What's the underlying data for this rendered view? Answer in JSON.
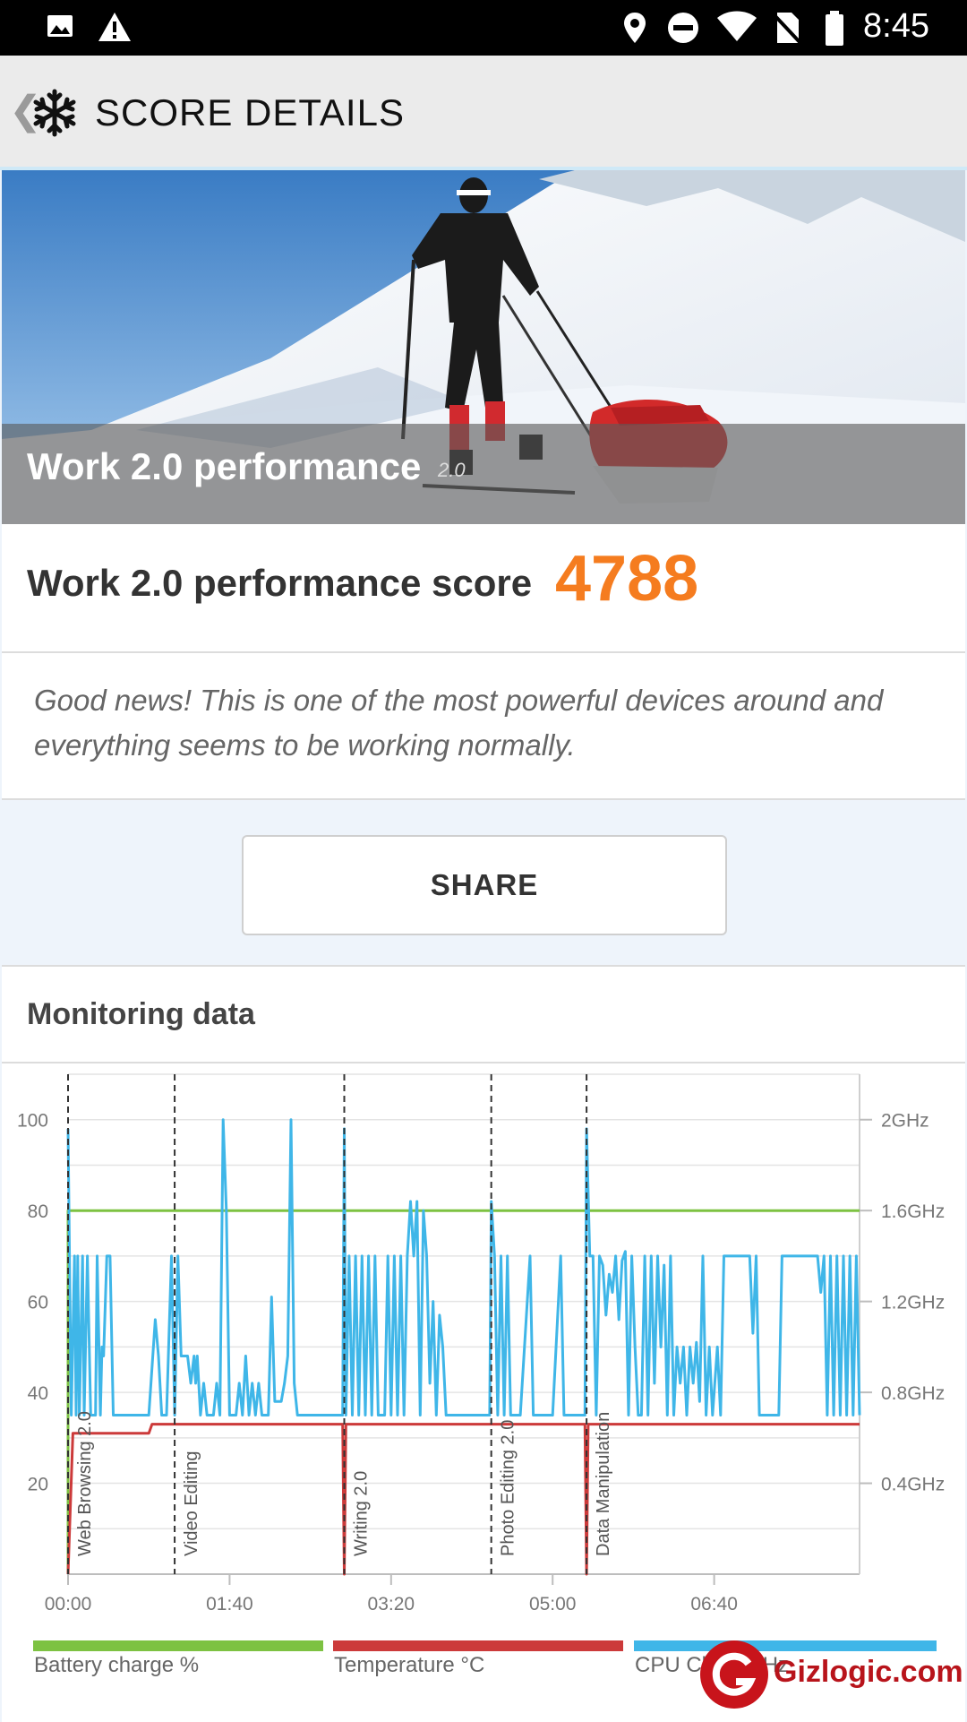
{
  "status_bar": {
    "time": "8:45",
    "icons": [
      "image-icon",
      "warning-icon",
      "location-icon",
      "dnd-icon",
      "wifi-icon",
      "no-sim-icon",
      "battery-icon"
    ]
  },
  "app_bar": {
    "title": "SCORE DETAILS",
    "icons": [
      "back-chevron-icon",
      "snowflake-icon"
    ]
  },
  "hero": {
    "title": "Work 2.0 performance",
    "version": "2.0"
  },
  "score": {
    "label": "Work 2.0 performance score",
    "value": "4788",
    "value_color": "#f57c1f"
  },
  "message": "Good news! This is one of the most powerful devices around and everything seems to be working normally.",
  "share_label": "SHARE",
  "monitoring": {
    "title": "Monitoring data",
    "legend": [
      {
        "label": "Battery charge %",
        "color": "#7dc242"
      },
      {
        "label": "Temperature °C",
        "color": "#cc3a3a"
      },
      {
        "label": "CPU Clock GHz",
        "color": "#3fb6e8"
      }
    ]
  },
  "watermark": "Gizlogic.com",
  "chart_data": {
    "type": "line",
    "x_unit": "mm:ss",
    "xlim": [
      0,
      490
    ],
    "x_ticks": [
      "00:00",
      "01:40",
      "03:20",
      "05:00",
      "06:40"
    ],
    "x_tick_values": [
      0,
      100,
      200,
      300,
      400
    ],
    "y_left_ticks": [
      "100",
      "80",
      "60",
      "40",
      "20"
    ],
    "y_left_tick_values": [
      100,
      80,
      60,
      40,
      20
    ],
    "ylim_left": [
      0,
      110
    ],
    "y_right_ticks": [
      "2GHz",
      "1.6GHz",
      "1.2GHz",
      "0.8GHz",
      "0.4GHz"
    ],
    "y_right_tick_values": [
      2.0,
      1.6,
      1.2,
      0.8,
      0.4
    ],
    "ylim_right": [
      0,
      2.2
    ],
    "grid": true,
    "legend_position": "bottom",
    "markers": [
      {
        "x": 0,
        "label": "Web Browsing 2.0"
      },
      {
        "x": 66,
        "label": "Video Editing"
      },
      {
        "x": 171,
        "label": "Writing 2.0"
      },
      {
        "x": 262,
        "label": "Photo Editing 2.0"
      },
      {
        "x": 321,
        "label": "Data Manipulation"
      }
    ],
    "series": [
      {
        "name": "Battery charge %",
        "axis": "left",
        "color": "#7dc242",
        "points": [
          [
            0,
            0
          ],
          [
            0,
            80
          ],
          [
            66,
            80
          ],
          [
            171,
            80
          ],
          [
            262,
            80
          ],
          [
            321,
            80
          ],
          [
            490,
            80
          ]
        ]
      },
      {
        "name": "Temperature °C",
        "axis": "left",
        "color": "#cc3a3a",
        "points": [
          [
            0,
            0
          ],
          [
            3,
            31
          ],
          [
            50,
            31
          ],
          [
            52,
            33
          ],
          [
            170,
            33
          ],
          [
            171,
            0
          ],
          [
            172,
            33
          ],
          [
            320,
            33
          ],
          [
            321,
            0
          ],
          [
            322,
            33
          ],
          [
            490,
            33
          ]
        ]
      },
      {
        "name": "CPU Clock GHz",
        "axis": "right",
        "color": "#3fb6e8",
        "points": [
          [
            0,
            1.96
          ],
          [
            2,
            0.7
          ],
          [
            4,
            1.4
          ],
          [
            5,
            0.7
          ],
          [
            6,
            1.4
          ],
          [
            7,
            0.7
          ],
          [
            9,
            1.4
          ],
          [
            10,
            0.7
          ],
          [
            12,
            1.4
          ],
          [
            14,
            0.7
          ],
          [
            17,
            0.7
          ],
          [
            18,
            1.4
          ],
          [
            20,
            0.7
          ],
          [
            21,
            1.0
          ],
          [
            22,
            0.96
          ],
          [
            24,
            1.4
          ],
          [
            26,
            1.4
          ],
          [
            28,
            0.7
          ],
          [
            40,
            0.7
          ],
          [
            50,
            0.7
          ],
          [
            54,
            1.12
          ],
          [
            56,
            0.96
          ],
          [
            58,
            0.7
          ],
          [
            61,
            0.7
          ],
          [
            64,
            1.4
          ],
          [
            66,
            0.7
          ],
          [
            68,
            1.4
          ],
          [
            70,
            0.96
          ],
          [
            74,
            0.96
          ],
          [
            76,
            0.84
          ],
          [
            78,
            0.96
          ],
          [
            79,
            0.84
          ],
          [
            80,
            0.96
          ],
          [
            82,
            0.7
          ],
          [
            84,
            0.84
          ],
          [
            86,
            0.7
          ],
          [
            90,
            0.7
          ],
          [
            92,
            0.84
          ],
          [
            94,
            0.7
          ],
          [
            96,
            2.0
          ],
          [
            98,
            1.6
          ],
          [
            100,
            0.7
          ],
          [
            104,
            0.7
          ],
          [
            106,
            0.84
          ],
          [
            108,
            0.7
          ],
          [
            110,
            0.96
          ],
          [
            112,
            0.7
          ],
          [
            114,
            0.84
          ],
          [
            116,
            0.7
          ],
          [
            118,
            0.84
          ],
          [
            120,
            0.7
          ],
          [
            124,
            0.7
          ],
          [
            126,
            1.22
          ],
          [
            128,
            0.76
          ],
          [
            132,
            0.76
          ],
          [
            134,
            0.84
          ],
          [
            136,
            0.96
          ],
          [
            138,
            2.0
          ],
          [
            140,
            0.84
          ],
          [
            142,
            0.7
          ],
          [
            150,
            0.7
          ],
          [
            170,
            0.7
          ],
          [
            171,
            1.96
          ],
          [
            172,
            0.7
          ],
          [
            174,
            1.4
          ],
          [
            176,
            0.7
          ],
          [
            178,
            1.4
          ],
          [
            180,
            0.7
          ],
          [
            182,
            1.4
          ],
          [
            184,
            0.7
          ],
          [
            186,
            1.4
          ],
          [
            188,
            0.7
          ],
          [
            190,
            1.4
          ],
          [
            192,
            0.7
          ],
          [
            196,
            0.7
          ],
          [
            198,
            1.4
          ],
          [
            200,
            0.7
          ],
          [
            202,
            1.4
          ],
          [
            204,
            0.7
          ],
          [
            206,
            1.4
          ],
          [
            208,
            0.7
          ],
          [
            210,
            1.4
          ],
          [
            212,
            1.64
          ],
          [
            214,
            1.4
          ],
          [
            216,
            1.64
          ],
          [
            218,
            0.7
          ],
          [
            220,
            1.6
          ],
          [
            222,
            1.4
          ],
          [
            224,
            0.84
          ],
          [
            226,
            1.2
          ],
          [
            228,
            0.7
          ],
          [
            230,
            1.14
          ],
          [
            232,
            1.0
          ],
          [
            234,
            0.7
          ],
          [
            240,
            0.7
          ],
          [
            248,
            0.7
          ],
          [
            256,
            0.7
          ],
          [
            261,
            0.7
          ],
          [
            262,
            1.64
          ],
          [
            264,
            1.4
          ],
          [
            266,
            0.7
          ],
          [
            268,
            1.4
          ],
          [
            270,
            0.7
          ],
          [
            272,
            1.4
          ],
          [
            274,
            0.7
          ],
          [
            278,
            0.7
          ],
          [
            280,
            0.7
          ],
          [
            286,
            1.4
          ],
          [
            288,
            0.7
          ],
          [
            300,
            0.7
          ],
          [
            305,
            1.4
          ],
          [
            307,
            0.7
          ],
          [
            318,
            0.7
          ],
          [
            320,
            0.7
          ],
          [
            321,
            1.96
          ],
          [
            323,
            1.4
          ],
          [
            325,
            1.4
          ],
          [
            327,
            0.7
          ],
          [
            329,
            1.4
          ],
          [
            331,
            1.36
          ],
          [
            333,
            1.14
          ],
          [
            335,
            1.32
          ],
          [
            337,
            1.24
          ],
          [
            339,
            1.4
          ],
          [
            341,
            1.12
          ],
          [
            343,
            1.38
          ],
          [
            345,
            1.42
          ],
          [
            347,
            0.7
          ],
          [
            349,
            1.4
          ],
          [
            351,
            1.0
          ],
          [
            353,
            0.7
          ],
          [
            355,
            0.7
          ],
          [
            357,
            1.4
          ],
          [
            359,
            0.7
          ],
          [
            361,
            1.4
          ],
          [
            363,
            0.84
          ],
          [
            365,
            1.4
          ],
          [
            367,
            1.0
          ],
          [
            369,
            1.36
          ],
          [
            371,
            0.7
          ],
          [
            373,
            1.4
          ],
          [
            375,
            0.7
          ],
          [
            377,
            1.0
          ],
          [
            379,
            0.84
          ],
          [
            381,
            1.0
          ],
          [
            383,
            0.7
          ],
          [
            385,
            1.0
          ],
          [
            387,
            0.84
          ],
          [
            389,
            1.02
          ],
          [
            391,
            0.76
          ],
          [
            393,
            1.4
          ],
          [
            395,
            0.7
          ],
          [
            397,
            1.0
          ],
          [
            399,
            0.7
          ],
          [
            402,
            1.0
          ],
          [
            404,
            0.7
          ],
          [
            406,
            1.4
          ],
          [
            410,
            1.4
          ],
          [
            414,
            1.4
          ],
          [
            418,
            1.4
          ],
          [
            422,
            1.4
          ],
          [
            424,
            1.06
          ],
          [
            426,
            1.4
          ],
          [
            428,
            0.7
          ],
          [
            440,
            0.7
          ],
          [
            442,
            1.4
          ],
          [
            444,
            1.4
          ],
          [
            458,
            1.4
          ],
          [
            464,
            1.4
          ],
          [
            466,
            1.24
          ],
          [
            468,
            1.4
          ],
          [
            470,
            0.7
          ],
          [
            472,
            1.4
          ],
          [
            474,
            0.7
          ],
          [
            476,
            1.4
          ],
          [
            478,
            0.7
          ],
          [
            480,
            1.4
          ],
          [
            482,
            0.7
          ],
          [
            484,
            1.4
          ],
          [
            486,
            0.7
          ],
          [
            488,
            1.4
          ],
          [
            490,
            0.7
          ]
        ]
      }
    ]
  }
}
